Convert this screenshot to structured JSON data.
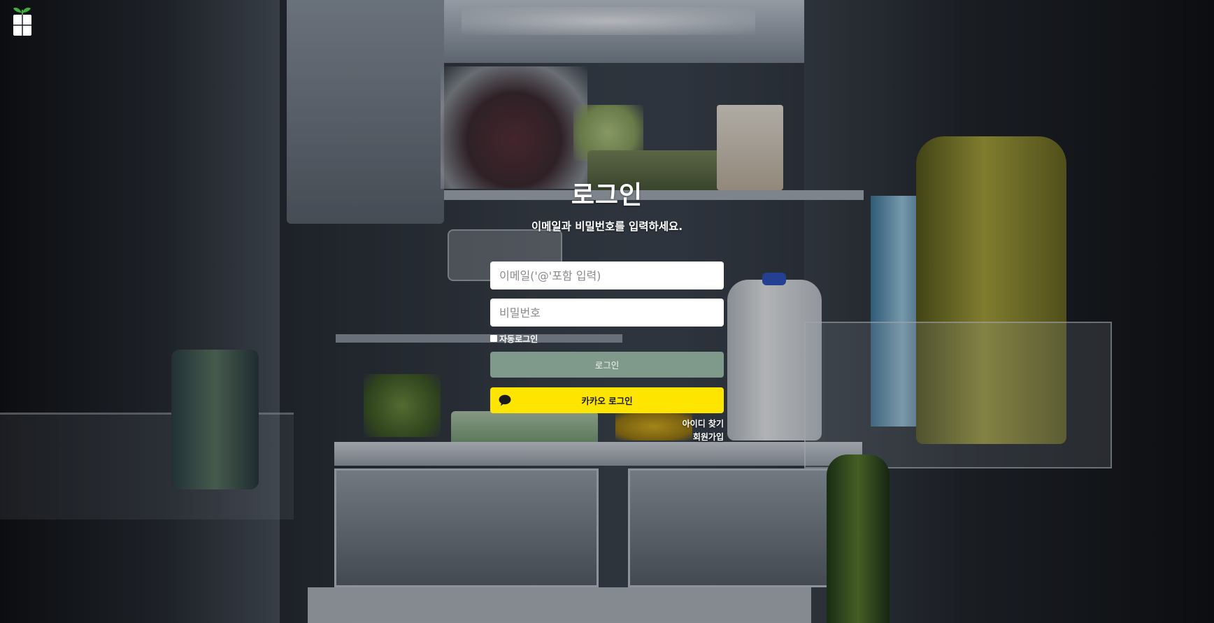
{
  "header": {
    "logo_icon": "fridge-sprout-icon"
  },
  "login": {
    "title": "로그인",
    "subtitle": "이메일과 비밀번호를 입력하세요.",
    "email_placeholder": "이메일('@'포함 입력)",
    "email_value": "",
    "password_placeholder": "비밀번호",
    "password_value": "",
    "auto_login_label": "자동로그인",
    "auto_login_checked": false,
    "login_button": "로그인",
    "kakao_button": "카카오 로그인",
    "kakao_icon": "speech-bubble-icon",
    "find_id_link": "아이디 찾기",
    "signup_link": "회원가입"
  },
  "colors": {
    "login_button": "#7f9a8b",
    "kakao_button": "#fee500",
    "text": "#ffffff"
  }
}
